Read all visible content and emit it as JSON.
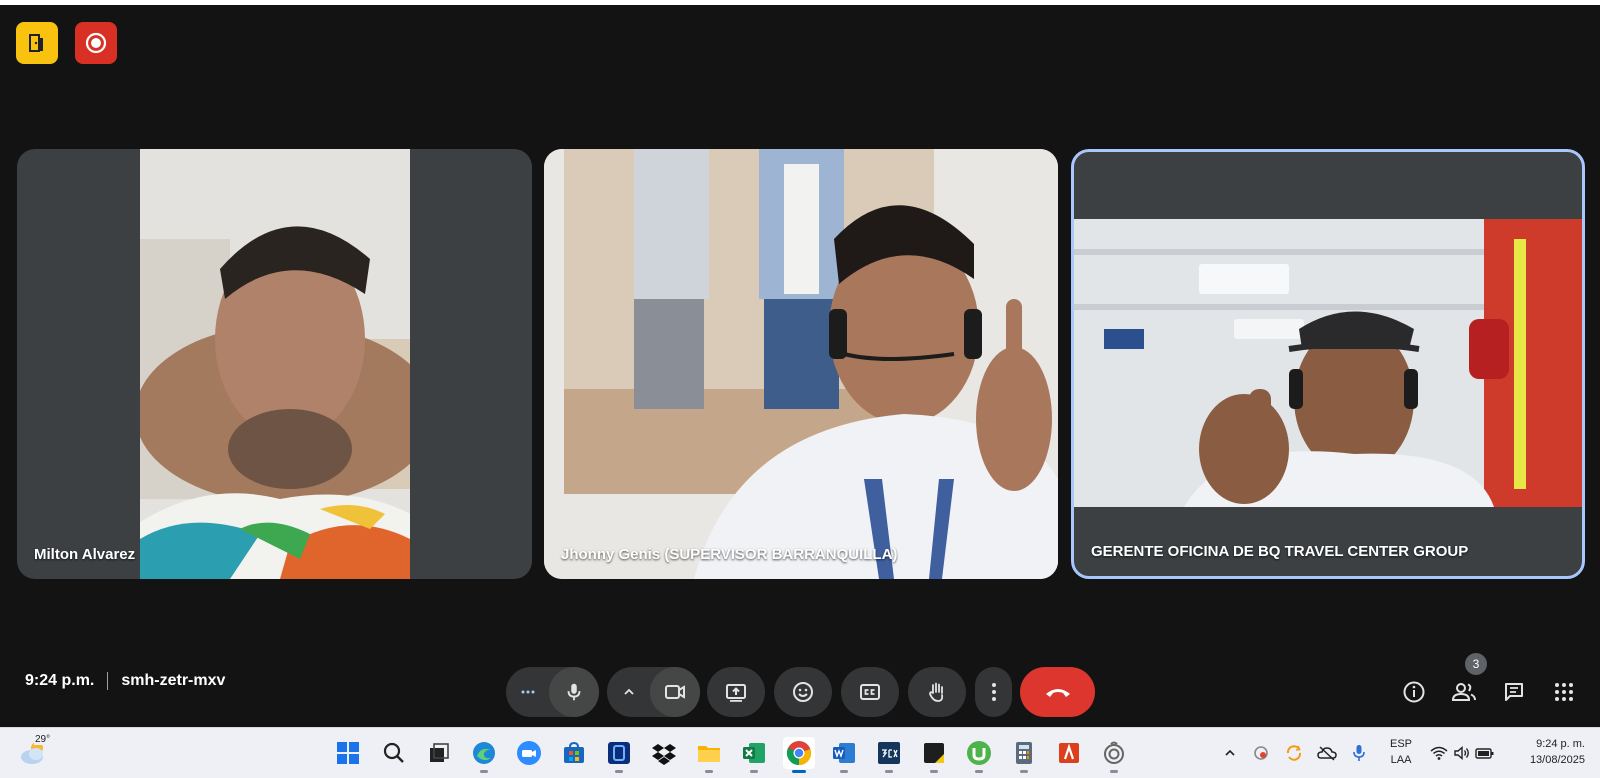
{
  "meeting": {
    "time": "9:24 p.m.",
    "code": "smh-zetr-mxv",
    "participant_count": "3"
  },
  "participants": [
    {
      "name": "Milton Alvarez"
    },
    {
      "name": "Jhonny Genis (SUPERVISOR BARRANQUILLA)"
    },
    {
      "name": "GERENTE OFICINA DE BQ TRAVEL CENTER GROUP"
    }
  ],
  "colors": {
    "background": "#131314",
    "tile": "#3c4043",
    "active_border": "#a8c7fa",
    "leave": "#dc362e",
    "host_controls": "#f9c20f",
    "recording": "#d93025"
  },
  "controls": [
    "more-options-icon",
    "microphone-icon",
    "chevron-up-icon",
    "camera-icon",
    "present-screen-icon",
    "emoji-icon",
    "captions-icon",
    "raise-hand-icon",
    "more-vert-icon",
    "hang-up-icon"
  ],
  "right_controls": [
    "info-icon",
    "people-icon",
    "chat-icon",
    "apps-icon"
  ],
  "taskbar": {
    "weather_temp": "29°",
    "lang_line1": "ESP",
    "lang_line2": "LAA",
    "clock_time": "9:24 p. m.",
    "clock_date": "13/08/2025",
    "apps": [
      "windows-start",
      "search",
      "task-view",
      "edge",
      "zoom",
      "store",
      "app-blue",
      "dropbox",
      "file-explorer",
      "excel",
      "chrome",
      "word",
      "3cx",
      "sticky",
      "utorrent",
      "calculator",
      "app-red",
      "app-ring"
    ]
  }
}
